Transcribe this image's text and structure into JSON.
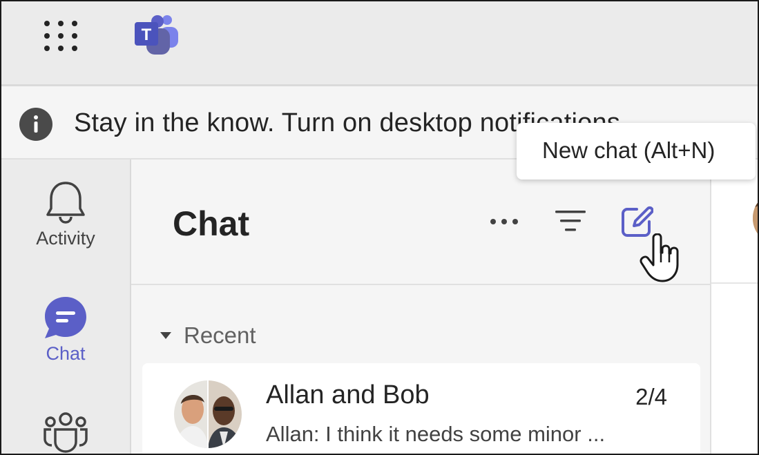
{
  "banner": {
    "text": "Stay in the know. Turn on desktop notifications"
  },
  "rail": {
    "items": [
      {
        "label": "Activity",
        "icon": "bell-icon"
      },
      {
        "label": "Chat",
        "icon": "chat-icon"
      },
      {
        "label": "",
        "icon": "teams-icon"
      }
    ]
  },
  "chat_panel": {
    "title": "Chat",
    "more_icon": "more-icon",
    "filter_icon": "filter-icon",
    "new_chat_icon": "new-chat-icon",
    "section": "Recent",
    "items": [
      {
        "name": "Allan and Bob",
        "date": "2/4",
        "preview": "Allan: I think it needs some minor ..."
      }
    ]
  },
  "tooltip": {
    "text": "New chat (Alt+N)"
  },
  "colors": {
    "accent": "#5b5fc7",
    "rail_bg": "#ebebeb",
    "panel_bg": "#f5f5f5"
  }
}
